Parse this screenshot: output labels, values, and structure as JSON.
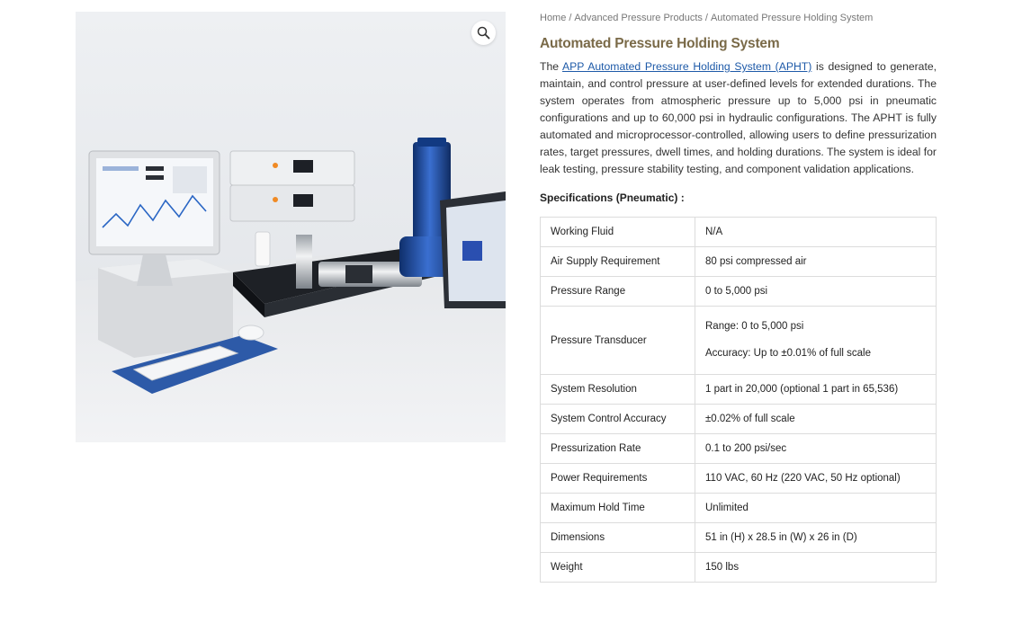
{
  "breadcrumb": {
    "home": "Home",
    "category": "Advanced Pressure Products",
    "current": "Automated Pressure Holding System",
    "separator": "/"
  },
  "product": {
    "title": "Automated Pressure Holding System",
    "description": {
      "prefix": "The ",
      "link_text": "APP Automated Pressure Holding System (APHT)",
      "rest": " is designed to generate, maintain, and control pressure at user-defined levels for extended durations. The system operates from atmospheric pressure up to 5,000 psi in pneumatic configurations and up to 60,000 psi in hydraulic configurations. The APHT is fully automated and microprocessor-controlled, allowing users to define pressurization rates, target pressures, dwell times, and holding durations. The system is ideal for leak testing, pressure stability testing, and component validation applications."
    }
  },
  "specs": {
    "heading": "Specifications (Pneumatic) :",
    "rows": [
      {
        "label": "Working Fluid",
        "value": "N/A"
      },
      {
        "label": "Air Supply Requirement",
        "value": "80 psi compressed air"
      },
      {
        "label": "Pressure Range",
        "value": "0 to 5,000 psi"
      },
      {
        "label": "Pressure Transducer",
        "value_line1": "Range: 0 to 5,000 psi",
        "value_line2": "Accuracy: Up to ±0.01% of full scale"
      },
      {
        "label": "System Resolution",
        "value": "1 part in 20,000 (optional 1 part in 65,536)"
      },
      {
        "label": "System Control Accuracy",
        "value": "±0.02% of full scale"
      },
      {
        "label": "Pressurization Rate",
        "value": "0.1 to 200 psi/sec"
      },
      {
        "label": "Power Requirements",
        "value": "110 VAC, 60 Hz (220 VAC, 50 Hz optional)"
      },
      {
        "label": "Maximum Hold Time",
        "value": "Unlimited"
      },
      {
        "label": "Dimensions",
        "value": "51 in (H) x 28.5 in (W) x 26 in (D)"
      },
      {
        "label": "Weight",
        "value": "150 lbs"
      }
    ]
  },
  "icons": {
    "zoom": "magnifier-icon"
  },
  "colors": {
    "title": "#7a6a48",
    "link": "#1e5aa8",
    "accent_blue": "#1f4fa3"
  }
}
